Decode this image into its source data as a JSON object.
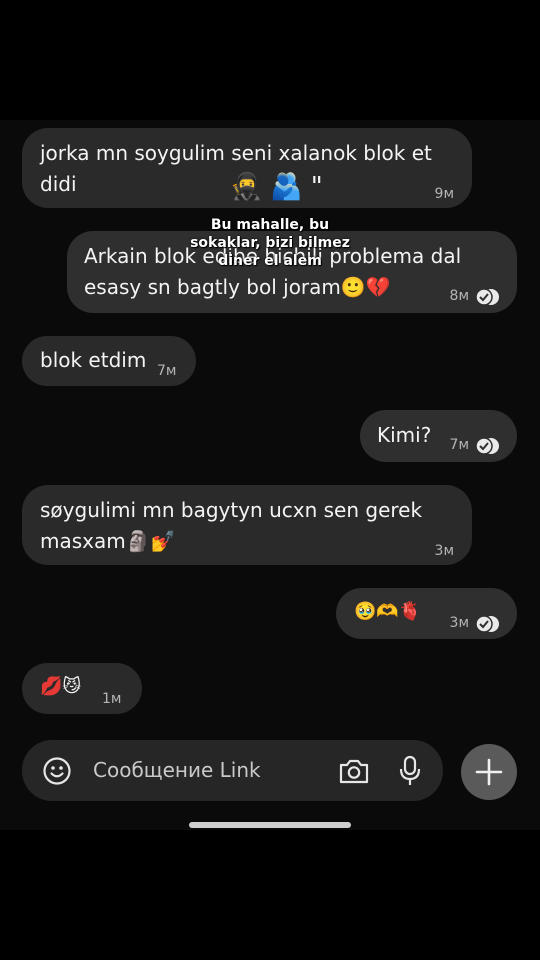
{
  "messages": [
    {
      "text": "jorka mn soygulim seni xalanok blok et\ndidi",
      "time": "9м"
    },
    {
      "text": "Arkain blok edibe hichili problema dal\nesasy sn bagtly bol joram🙂💔",
      "time": "8м"
    },
    {
      "text": "blok etdim",
      "time": "7м"
    },
    {
      "text": "Kimi?",
      "time": "7м"
    },
    {
      "text": "søygulimi mn bagytyn ucxn sen gerek\nmasxam🗿💅",
      "time": "3м"
    },
    {
      "text": "🥹🫶🫀",
      "time": "3м"
    },
    {
      "text": "💋😼",
      "time": "1м"
    }
  ],
  "sticker": {
    "emoji": "🥷🫂\"",
    "text": "Bu mahalle, bu\nsokaklar, bizi bilmez\ndiner el alem"
  },
  "composer": {
    "placeholder": "Сообщение Link"
  },
  "icons": {
    "emoji": "smiley-icon",
    "camera": "camera-icon",
    "mic": "microphone-icon",
    "plus": "plus-icon",
    "read": "read-check-icon"
  }
}
